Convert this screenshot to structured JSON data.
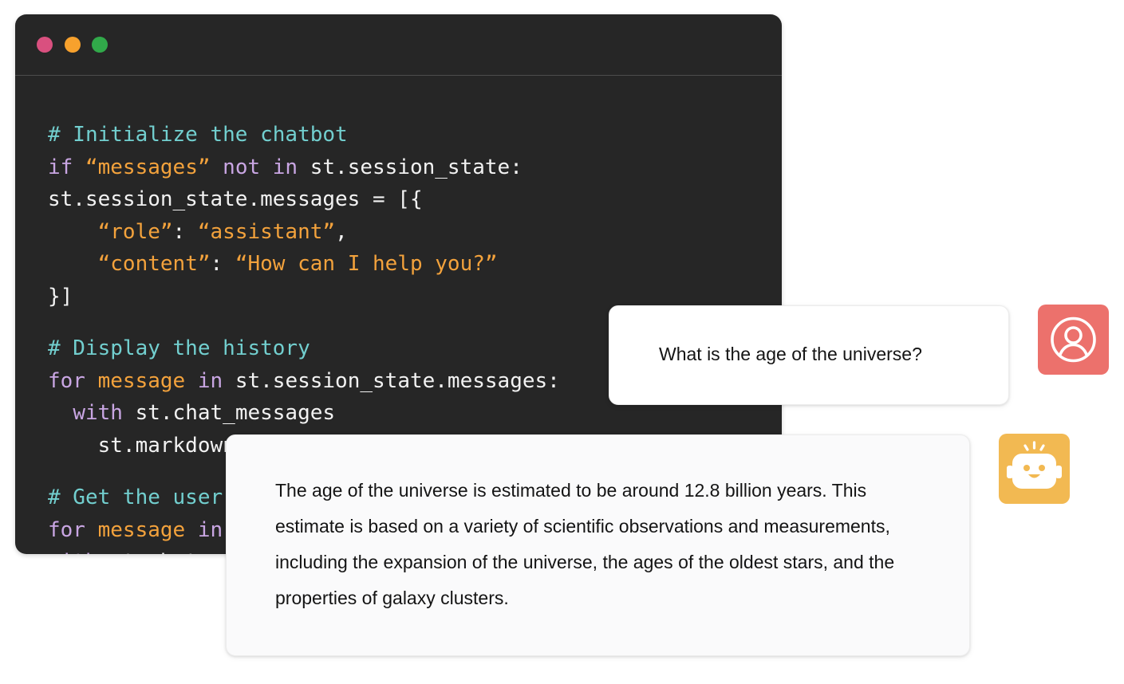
{
  "editor": {
    "window_controls": [
      {
        "name": "close",
        "color": "#d9507f"
      },
      {
        "name": "minimize",
        "color": "#f7a12d"
      },
      {
        "name": "maximize",
        "color": "#31a94a"
      }
    ],
    "code_lines": [
      [
        {
          "type": "comment",
          "text": "# Initialize the chatbot"
        }
      ],
      [
        {
          "type": "keyword",
          "text": "if "
        },
        {
          "type": "string",
          "text": "“messages”"
        },
        {
          "type": "keyword",
          "text": " not in "
        },
        {
          "type": "plain",
          "text": "st.session_state:"
        }
      ],
      [
        {
          "type": "plain",
          "text": "st.session_state.messages = [{"
        }
      ],
      [
        {
          "type": "plain",
          "text": "    "
        },
        {
          "type": "string",
          "text": "“role”"
        },
        {
          "type": "plain",
          "text": ": "
        },
        {
          "type": "string",
          "text": "“assistant”"
        },
        {
          "type": "plain",
          "text": ","
        }
      ],
      [
        {
          "type": "plain",
          "text": "    "
        },
        {
          "type": "string",
          "text": "“content”"
        },
        {
          "type": "plain",
          "text": ": "
        },
        {
          "type": "string",
          "text": "“How can I help you?”"
        }
      ],
      [
        {
          "type": "plain",
          "text": "}]"
        }
      ],
      "gap",
      [
        {
          "type": "comment",
          "text": "# Display the history"
        }
      ],
      [
        {
          "type": "keyword",
          "text": "for "
        },
        {
          "type": "string",
          "text": "message"
        },
        {
          "type": "keyword",
          "text": " in "
        },
        {
          "type": "plain",
          "text": "st.session_state.messages:"
        }
      ],
      [
        {
          "type": "plain",
          "text": "  "
        },
        {
          "type": "keyword",
          "text": "with "
        },
        {
          "type": "plain",
          "text": "st.chat_messages"
        }
      ],
      [
        {
          "type": "plain",
          "text": "    st.markdown"
        }
      ],
      "gap",
      [
        {
          "type": "comment",
          "text": "# Get the user"
        }
      ],
      [
        {
          "type": "keyword",
          "text": "for "
        },
        {
          "type": "string",
          "text": "message"
        },
        {
          "type": "keyword",
          "text": " in"
        }
      ],
      [
        {
          "type": "keyword",
          "text": "with "
        },
        {
          "type": "plain",
          "text": "st.chat"
        }
      ]
    ],
    "colors": {
      "background": "#262626",
      "comment": "#72cfcf",
      "keyword": "#c9a6e3",
      "string": "#f3a23c",
      "plain": "#f2f2f2"
    }
  },
  "chat": {
    "user_message": "What is the age of the universe?",
    "assistant_message": "The age of the universe is estimated to be around 12.8 billion years. This estimate is based on a variety of scientific observations and measurements, including the expansion of the universe, the ages of the oldest stars, and the properties of galaxy clusters.",
    "user_avatar": {
      "icon": "user-circle-icon",
      "color": "#ec716c"
    },
    "bot_avatar": {
      "icon": "robot-icon",
      "color": "#f2b952"
    }
  }
}
